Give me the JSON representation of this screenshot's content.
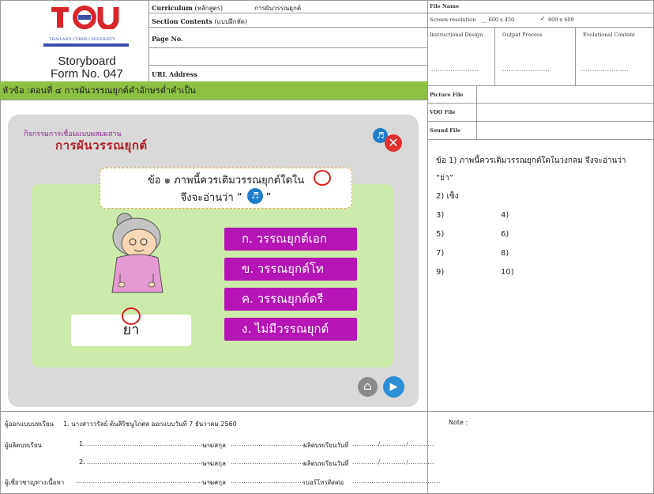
{
  "header": {
    "logo_text": "TCU",
    "logo_subtext": "THAILAND CYBER UNIVERSITY",
    "storyboard_line1": "Storyboard",
    "storyboard_line2": "Form No. 047",
    "curriculum_label": "Curriculum",
    "curriculum_sub": "(หลักสูตร)",
    "curriculum_value": "การผันวรรณยุกต์",
    "section_label": "Section Contents",
    "section_sub": "(แบบฝึกหัด)",
    "page_label": "Page No.",
    "url_label": "URL Address",
    "file_name_label": "File Name",
    "screen_res_label": "Screen resolution",
    "res_option_1": "600 x 450",
    "res_option_2": "800 x 600",
    "res_check_mark": "✓",
    "instructional_design": "Instructional Design",
    "output_process": "Output Process",
    "evolutional_content": "Evolutional Content",
    "picture_file": "Picture File",
    "vdo_file": "VDO File",
    "sound_file": "Sound File"
  },
  "topic": "หัวข้อ :ตอนที่ ๔ การผันวรรณยุกต์คำอักษรต่ำคำเป็น",
  "screen": {
    "activity_label": "กิจกรรมการเชื่อมแบบผสมผสาน",
    "heading": "การผันวรรณยุกต์",
    "question_line1": "ข้อ ๑ ภาพนี้ควรเติมวรรณยุกต์ใดใน",
    "question_line2_pre": "จึงจะอ่านว่า “",
    "question_line2_post": "”",
    "choices": [
      "ก.  วรรณยุกต์เอก",
      "ข.  วรรณยุกต์โท",
      "ค.  วรรณยุกต์ตรี",
      "ง.  ไม่มีวรรณยุกต์"
    ],
    "word": "ยา",
    "speaker_icon": "speaker-icon",
    "close_icon": "close-icon",
    "home_icon": "home-icon",
    "next_icon": "next-arrow-icon",
    "colors": {
      "topic_bar": "#8dc043",
      "choice_bg": "#b415b4",
      "green_area": "#ccebaa",
      "heading": "#b0222a"
    }
  },
  "right_panel": {
    "question_line1": "ข้อ 1) ภาพนี้ควรเติมวรรณยุกต์ใดในวงกลม จึงจะอ่านว่า",
    "question_line2": "“ย่า”",
    "answer": "2) เซ็ง",
    "numbers": [
      "3)",
      "4)",
      "5)",
      "6)",
      "7)",
      "8)",
      "9)",
      "10)"
    ]
  },
  "footer": {
    "designer_label": "ผู้ออกแบบบทเรียน",
    "designer_value": "1. นางสาววรัลย์  ต้นสิริชนูโภศล  ออกแบบวันที่  7  ธันวาคม 2560",
    "producer_label": "ผู้ผลิตบทเรียน",
    "producer_1": "1.",
    "producer_2": "2.",
    "surname_label": "นามสกุล",
    "produced_date_label": "ผลิตบทเรียนวันที่",
    "expert_label": "ผู้เชี่ยวชาญทางเนื้อหา",
    "phone_label": "เบอร์โทรติดต่อ",
    "note_label": "Note :"
  }
}
